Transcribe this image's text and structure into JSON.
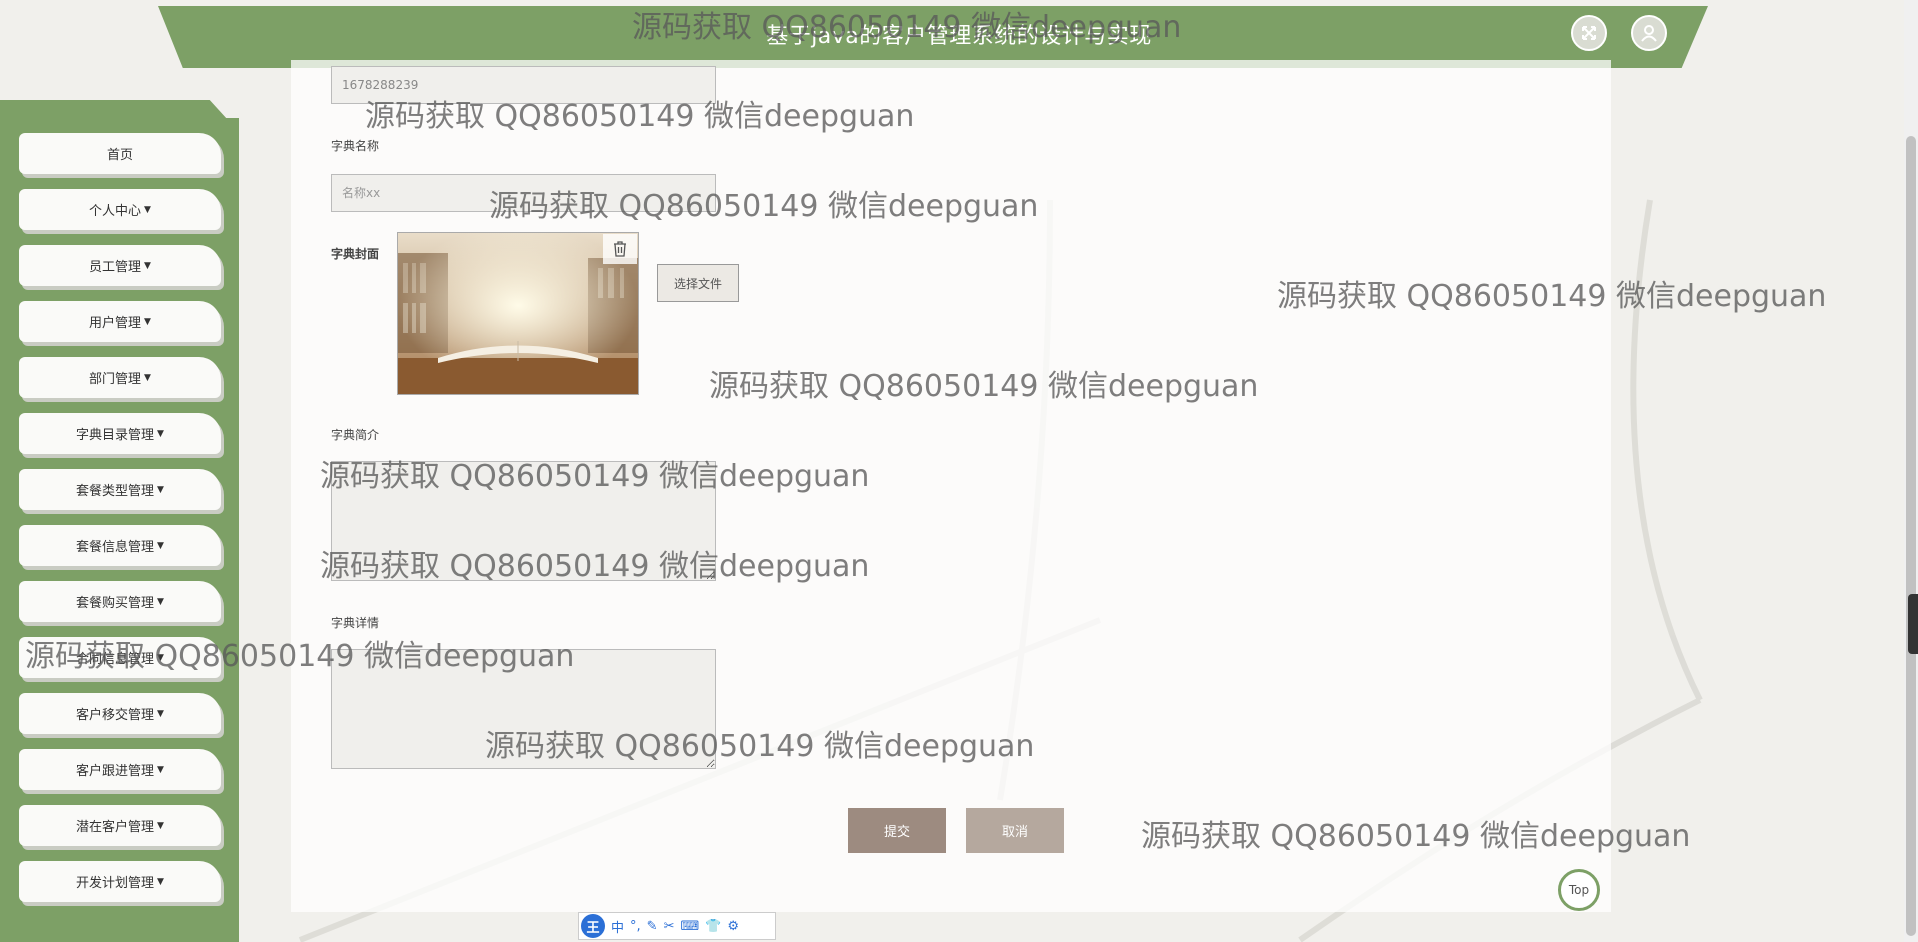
{
  "header": {
    "title": "基于java的客户管理系统的设计与实现"
  },
  "sidebar": {
    "items": [
      {
        "label": "首页",
        "caret": false
      },
      {
        "label": "个人中心",
        "caret": true
      },
      {
        "label": "员工管理",
        "caret": true
      },
      {
        "label": "用户管理",
        "caret": true
      },
      {
        "label": "部门管理",
        "caret": true
      },
      {
        "label": "字典目录管理",
        "caret": true
      },
      {
        "label": "套餐类型管理",
        "caret": true
      },
      {
        "label": "套餐信息管理",
        "caret": true
      },
      {
        "label": "套餐购买管理",
        "caret": true
      },
      {
        "label": "合同信息管理",
        "caret": true
      },
      {
        "label": "客户移交管理",
        "caret": true
      },
      {
        "label": "客户跟进管理",
        "caret": true
      },
      {
        "label": "潜在客户管理",
        "caret": true
      },
      {
        "label": "开发计划管理",
        "caret": true
      }
    ]
  },
  "form": {
    "code_value": "1678288239",
    "name_label": "字典名称",
    "name_placeholder": "名称xx",
    "cover_label": "字典封面",
    "file_button": "选择文件",
    "intro_label": "字典简介",
    "intro_value": "",
    "detail_label": "字典详情",
    "detail_value": "",
    "submit": "提交",
    "cancel": "取消"
  },
  "top_button": "Top",
  "ime": {
    "logo": "王",
    "mode": "中"
  },
  "watermark_text": "源码获取 QQ86050149 微信deepguan",
  "colors": {
    "theme_green": "#7da066",
    "submit_bg": "#9d8b80",
    "cancel_bg": "#b5a89e"
  }
}
